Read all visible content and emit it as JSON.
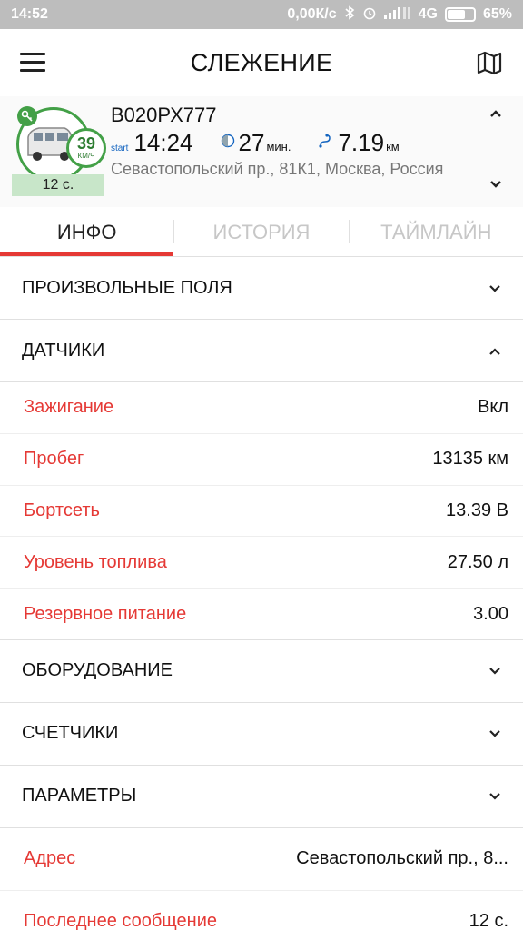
{
  "status_bar": {
    "time": "14:52",
    "net_speed": "0,00К/с",
    "network": "4G",
    "battery": "65%",
    "icons": [
      "bluetooth-icon",
      "alarm-icon",
      "signal-icon",
      "battery-icon"
    ]
  },
  "appbar": {
    "title": "СЛЕЖЕНИЕ",
    "icons": [
      "menu-icon",
      "map-icon"
    ]
  },
  "unit": {
    "name": "В020РХ777",
    "speed": "39",
    "speed_unit": "КМ/Ч",
    "age": "12 с.",
    "start_label": "start",
    "start_time": "14:24",
    "duration": "27",
    "duration_unit": "мин.",
    "distance": "7.19",
    "distance_unit": "км",
    "address": "Севастопольский пр., 81К1, Москва, Россия"
  },
  "tabs": [
    {
      "label": "ИНФО",
      "active": true
    },
    {
      "label": "ИСТОРИЯ",
      "active": false
    },
    {
      "label": "ТАЙМЛАЙН",
      "active": false
    }
  ],
  "sections": {
    "custom_fields": "ПРОИЗВОЛЬНЫЕ ПОЛЯ",
    "sensors": "ДАТЧИКИ",
    "equipment": "ОБОРУДОВАНИЕ",
    "counters": "СЧЕТЧИКИ",
    "params": "ПАРАМЕТРЫ"
  },
  "sensors": [
    {
      "label": "Зажигание",
      "value": "Вкл"
    },
    {
      "label": "Пробег",
      "value": "13135 км"
    },
    {
      "label": "Бортсеть",
      "value": "13.39 В"
    },
    {
      "label": "Уровень топлива",
      "value": "27.50 л"
    },
    {
      "label": "Резервное питание",
      "value": "3.00"
    }
  ],
  "info_rows": [
    {
      "label": "Адрес",
      "value": "Севастопольский пр., 8..."
    },
    {
      "label": "Последнее сообщение",
      "value": "12 с."
    }
  ],
  "colors": {
    "accent": "#e53935",
    "status_green": "#43a047",
    "age_badge": "#c8e6c9"
  }
}
